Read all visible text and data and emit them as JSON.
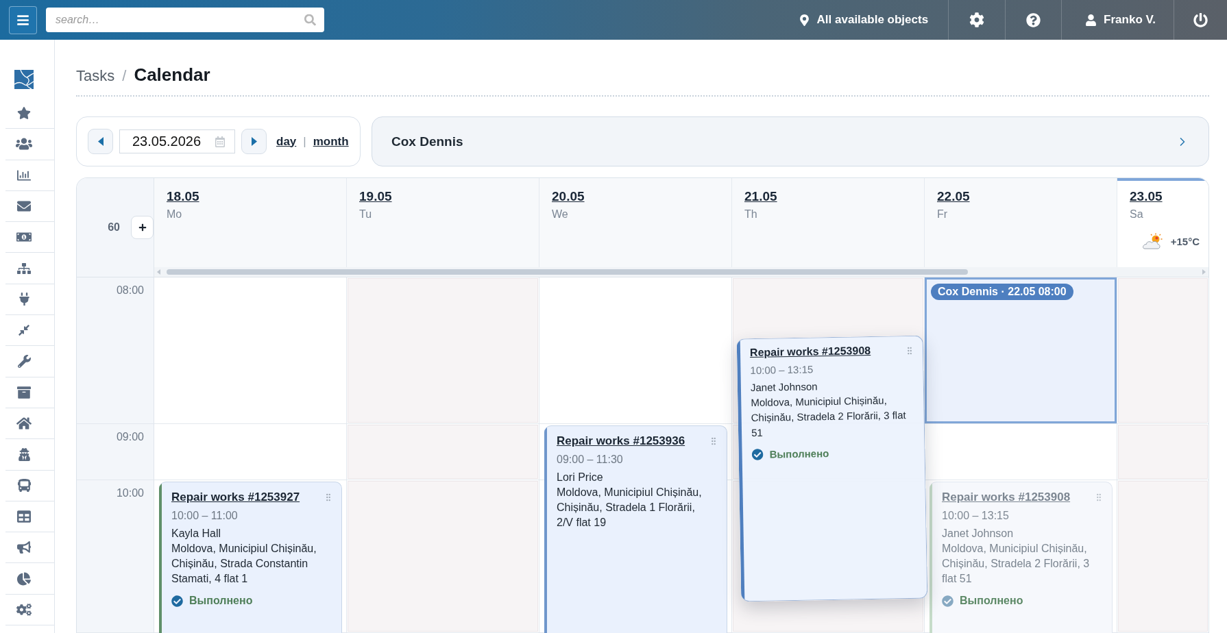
{
  "top_bar": {
    "search": {
      "placeholder": "search…"
    },
    "location": "All available objects",
    "user": "Franko V."
  },
  "breadcrumb": {
    "items": [
      "Tasks",
      "Calendar"
    ],
    "separator": "/"
  },
  "toolbar": {
    "date": "23.05.2026",
    "views": [
      "day",
      "month"
    ],
    "view_separator": "|"
  },
  "assignee": {
    "name": "Cox Dennis"
  },
  "calendar": {
    "slot_minutes": "60",
    "days": [
      {
        "date": "18.05",
        "weekday": "Mo",
        "today": false
      },
      {
        "date": "19.05",
        "weekday": "Tu",
        "today": false
      },
      {
        "date": "20.05",
        "weekday": "We",
        "today": false
      },
      {
        "date": "21.05",
        "weekday": "Th",
        "today": false
      },
      {
        "date": "22.05",
        "weekday": "Fr",
        "today": false
      },
      {
        "date": "23.05",
        "weekday": "Sa",
        "today": true,
        "weather": {
          "temperature": "+15°C"
        }
      }
    ],
    "rows": [
      {
        "time": "08:00",
        "cells": [
          {
            "shaded": false,
            "highlighted": false
          },
          {
            "shaded": true,
            "highlighted": false
          },
          {
            "shaded": false,
            "highlighted": false
          },
          {
            "shaded": true,
            "highlighted": false
          },
          {
            "shaded": false,
            "highlighted": true,
            "badge": "Cox Dennis · 22.05 08:00"
          },
          {
            "shaded": true,
            "highlighted": false
          }
        ]
      },
      {
        "time": "09:00",
        "cells": [
          {
            "shaded": false,
            "highlighted": false
          },
          {
            "shaded": true,
            "highlighted": false
          },
          {
            "shaded": false,
            "highlighted": false,
            "events": [
              {
                "kind": "task",
                "color": "#6f96cb",
                "title": "Repair works #1253936",
                "time": "09:00 – 11:30",
                "person": "Lori Price",
                "address": "Moldova, Municipiul Chișinău, Chișinău, Stradela 1 Florării, 2/V flat 19"
              }
            ]
          },
          {
            "shaded": true,
            "highlighted": false
          },
          {
            "shaded": false,
            "highlighted": false
          },
          {
            "shaded": true,
            "highlighted": false
          }
        ]
      },
      {
        "time": "10:00",
        "cells": [
          {
            "shaded": false,
            "highlighted": false,
            "events": [
              {
                "kind": "task",
                "color": "#5f8f69",
                "title": "Repair works #1253927",
                "time": "10:00 – 11:00",
                "person": "Kayla Hall",
                "address": "Moldova, Municipiul Chișinău, Chișinău, Strada Constantin Stamati, 4 flat 1",
                "status": "Выполнено"
              }
            ]
          },
          {
            "shaded": true,
            "highlighted": false
          },
          {
            "shaded": false,
            "highlighted": false
          },
          {
            "shaded": true,
            "highlighted": false
          },
          {
            "shaded": false,
            "highlighted": false,
            "events": [
              {
                "kind": "ghost",
                "color": "#c6dcc9",
                "title": "Repair works #1253908",
                "time": "10:00 – 13:15",
                "person": "Janet Johnson",
                "address": "Moldova, Municipiul Chișinău, Chișinău, Stradela 2 Florării, 3 flat 51",
                "status": "Выполнено"
              }
            ]
          },
          {
            "shaded": true,
            "highlighted": false
          }
        ]
      }
    ],
    "drag_preview": {
      "color": "#4f7fbf",
      "title": "Repair works #1253908",
      "time": "10:00 – 13:15",
      "person": "Janet Johnson",
      "address": "Moldova, Municipiul Chișinău, Chișinău, Stradela 2 Florării, 3 flat 51",
      "status": "Выполнено"
    }
  }
}
